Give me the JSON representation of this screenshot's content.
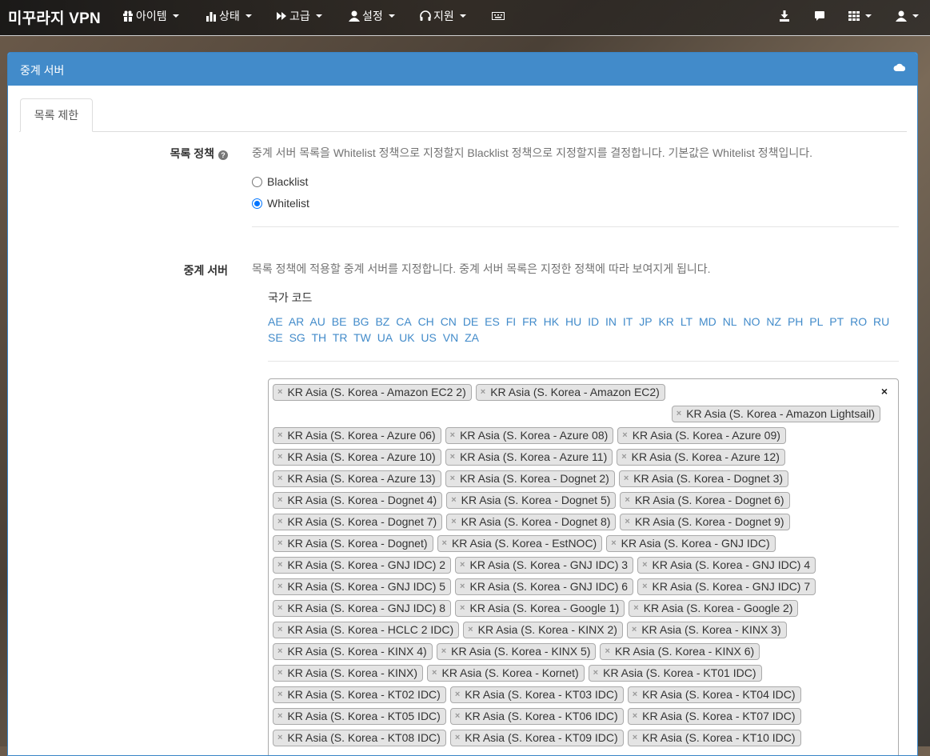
{
  "navbar": {
    "brand": "미꾸라지 VPN",
    "items": [
      {
        "label": "아이템",
        "icon": "gift-icon"
      },
      {
        "label": "상태",
        "icon": "bar-chart-icon"
      },
      {
        "label": "고급",
        "icon": "fast-forward-icon"
      },
      {
        "label": "설정",
        "icon": "user-icon"
      },
      {
        "label": "지원",
        "icon": "headphones-icon"
      }
    ],
    "right_icons": [
      "keyboard-icon",
      "download-icon",
      "comment-icon",
      "grid-icon",
      "user-menu-icon"
    ]
  },
  "panel": {
    "title": "중계 서버",
    "title_icon": "cloud-icon",
    "tab": "목록 제한"
  },
  "policy": {
    "label": "목록 정책",
    "description": "중계 서버 목록을 Whitelist 정책으로 지정할지 Blacklist 정책으로 지정할지를 결정합니다. 기본값은 Whitelist 정책입니다.",
    "options": [
      {
        "label": "Blacklist",
        "checked": false
      },
      {
        "label": "Whitelist",
        "checked": true
      }
    ]
  },
  "servers": {
    "label": "중계 서버",
    "description": "목록 정책에 적용할 중계 서버를 지정합니다. 중계 서버 목록은 지정한 정책에 따라 보여지게 됩니다.",
    "country_code_label": "국가 코드",
    "country_codes": [
      "AE",
      "AR",
      "AU",
      "BE",
      "BG",
      "BZ",
      "CA",
      "CH",
      "CN",
      "DE",
      "ES",
      "FI",
      "FR",
      "HK",
      "HU",
      "ID",
      "IN",
      "IT",
      "JP",
      "KR",
      "LT",
      "MD",
      "NL",
      "NO",
      "NZ",
      "PH",
      "PL",
      "PT",
      "RO",
      "RU",
      "SE",
      "SG",
      "TH",
      "TR",
      "TW",
      "UA",
      "UK",
      "US",
      "VN",
      "ZA"
    ],
    "clear_symbol": "×",
    "remove_symbol": "×",
    "selected_rows": [
      [
        "KR Asia (S. Korea - Amazon EC2 2)",
        "KR Asia (S. Korea - Amazon EC2)"
      ],
      [
        "KR Asia (S. Korea - Amazon Lightsail)"
      ],
      [
        "KR Asia (S. Korea - Azure 06)",
        "KR Asia (S. Korea - Azure 08)",
        "KR Asia (S. Korea - Azure 09)"
      ],
      [
        "KR Asia (S. Korea - Azure 10)",
        "KR Asia (S. Korea - Azure 11)",
        "KR Asia (S. Korea - Azure 12)"
      ],
      [
        "KR Asia (S. Korea - Azure 13)",
        "KR Asia (S. Korea - Dognet 2)",
        "KR Asia (S. Korea - Dognet 3)"
      ],
      [
        "KR Asia (S. Korea - Dognet 4)",
        "KR Asia (S. Korea - Dognet 5)",
        "KR Asia (S. Korea - Dognet 6)"
      ],
      [
        "KR Asia (S. Korea - Dognet 7)",
        "KR Asia (S. Korea - Dognet 8)",
        "KR Asia (S. Korea - Dognet 9)"
      ],
      [
        "KR Asia (S. Korea - Dognet)",
        "KR Asia (S. Korea - EstNOC)",
        "KR Asia (S. Korea - GNJ IDC)"
      ],
      [
        "KR Asia (S. Korea - GNJ IDC) 2",
        "KR Asia (S. Korea - GNJ IDC) 3",
        "KR Asia (S. Korea - GNJ IDC) 4"
      ],
      [
        "KR Asia (S. Korea - GNJ IDC) 5",
        "KR Asia (S. Korea - GNJ IDC) 6",
        "KR Asia (S. Korea - GNJ IDC) 7"
      ],
      [
        "KR Asia (S. Korea - GNJ IDC) 8",
        "KR Asia (S. Korea - Google 1)",
        "KR Asia (S. Korea - Google 2)"
      ],
      [
        "KR Asia (S. Korea - HCLC 2 IDC)",
        "KR Asia (S. Korea - KINX 2)",
        "KR Asia (S. Korea - KINX 3)"
      ],
      [
        "KR Asia (S. Korea - KINX 4)",
        "KR Asia (S. Korea - KINX 5)",
        "KR Asia (S. Korea - KINX 6)"
      ],
      [
        "KR Asia (S. Korea - KINX)",
        "KR Asia (S. Korea - Kornet)",
        "KR Asia (S. Korea - KT01 IDC)"
      ],
      [
        "KR Asia (S. Korea - KT02 IDC)",
        "KR Asia (S. Korea - KT03 IDC)",
        "KR Asia (S. Korea - KT04 IDC)"
      ],
      [
        "KR Asia (S. Korea - KT05 IDC)",
        "KR Asia (S. Korea - KT06 IDC)",
        "KR Asia (S. Korea - KT07 IDC)"
      ],
      [
        "KR Asia (S. Korea - KT08 IDC)",
        "KR Asia (S. Korea - KT09 IDC)",
        "KR Asia (S. Korea - KT10 IDC)"
      ]
    ]
  },
  "colors": {
    "panel_heading": "#428bca",
    "link": "#428bca",
    "radio_checked": "#0075ff"
  }
}
